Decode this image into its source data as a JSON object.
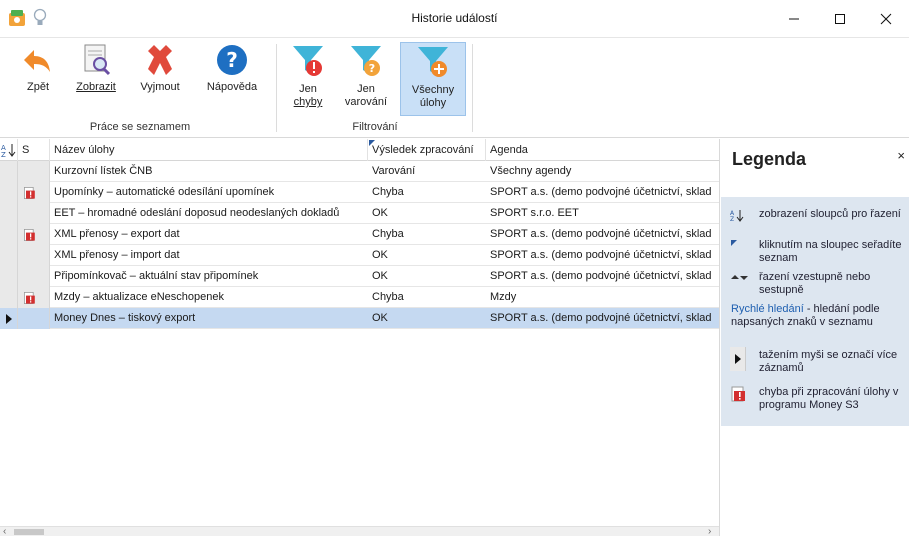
{
  "window": {
    "title": "Historie událostí"
  },
  "ribbon": {
    "buttons": [
      {
        "label": "Zpět",
        "icon": "back-arrow-icon"
      },
      {
        "label": "Zobrazit",
        "icon": "view-document-icon"
      },
      {
        "label": "Vyjmout",
        "icon": "delete-x-icon"
      },
      {
        "label": "Nápověda",
        "icon": "help-icon"
      },
      {
        "label": "Jen chyby",
        "line1": "Jen",
        "line2": "chyby",
        "icon": "filter-error-icon"
      },
      {
        "label": "Jen varování",
        "line1": "Jen",
        "line2": "varování",
        "icon": "filter-warning-icon"
      },
      {
        "label": "Všechny úlohy",
        "line1": "Všechny",
        "line2": "úlohy",
        "icon": "filter-all-icon"
      }
    ],
    "groups": {
      "list": "Práce se seznamem",
      "filter": "Filtrování"
    }
  },
  "grid": {
    "columns": [
      "S",
      "Název úlohy",
      "Výsledek zpracování",
      "Agenda"
    ],
    "rows": [
      {
        "name": "Kurzovní lístek ČNB",
        "result": "Varování",
        "agenda": "Všechny agendy",
        "error": false,
        "selected": false
      },
      {
        "name": "Upomínky – automatické odesílání upomínek",
        "result": "Chyba",
        "agenda": "SPORT a.s. (demo podvojné účetnictví, sklad",
        "error": true,
        "selected": false
      },
      {
        "name": "EET – hromadné odeslání doposud neodeslaných dokladů",
        "result": "OK",
        "agenda": "SPORT s.r.o. EET",
        "error": false,
        "selected": false
      },
      {
        "name": "XML přenosy – export dat",
        "result": "Chyba",
        "agenda": "SPORT a.s. (demo podvojné účetnictví, sklad",
        "error": true,
        "selected": false
      },
      {
        "name": "XML přenosy – import dat",
        "result": "OK",
        "agenda": "SPORT a.s. (demo podvojné účetnictví, sklad",
        "error": false,
        "selected": false
      },
      {
        "name": "Připomínkovač – aktuální stav připomínek",
        "result": "OK",
        "agenda": "SPORT a.s. (demo podvojné účetnictví, sklad",
        "error": false,
        "selected": false
      },
      {
        "name": "Mzdy – aktualizace eNeschopenek",
        "result": "Chyba",
        "agenda": "Mzdy",
        "error": true,
        "selected": false
      },
      {
        "name": "Money Dnes – tiskový export",
        "result": "OK",
        "agenda": "SPORT a.s. (demo podvojné účetnictví, sklad",
        "error": false,
        "selected": true
      }
    ]
  },
  "legend": {
    "title": "Legenda",
    "close": "×",
    "items": [
      {
        "icon": "column-chooser-icon",
        "text": "zobrazení sloupců pro řazení"
      },
      {
        "icon": "sort-marker-icon",
        "text": "kliknutím na sloupec seřadíte seznam"
      },
      {
        "icon": "sort-direction-icon",
        "text": "řazení vzestupně nebo sestupně"
      },
      {
        "icon": "",
        "prefix": "Rychlé hledání",
        "text": " - hledání podle napsaných znaků v seznamu"
      },
      {
        "icon": "row-indicator-icon",
        "text": "tažením myši se označí více záznamů"
      },
      {
        "icon": "error-icon",
        "text": "chyba při zpracování úlohy v programu Money S3"
      }
    ]
  },
  "colors": {
    "selection": "#c5d9f1",
    "legend_bg": "#dde6f0",
    "error_red": "#d32f2f",
    "filter_teal": "#3fb4d8",
    "help_blue": "#1e6fc2"
  }
}
